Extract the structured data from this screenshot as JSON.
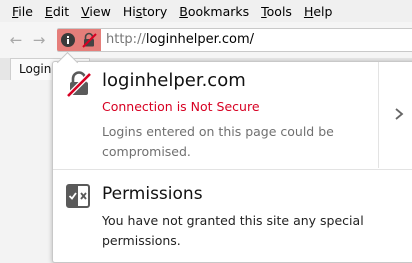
{
  "menu": [
    {
      "key": "F",
      "rest": "ile"
    },
    {
      "key": "E",
      "rest": "dit"
    },
    {
      "key": "V",
      "rest": "iew"
    },
    {
      "key": "",
      "pre": "Hi",
      "ul": "s",
      "rest": "tory"
    },
    {
      "key": "B",
      "rest": "ookmarks"
    },
    {
      "key": "T",
      "rest": "ools"
    },
    {
      "key": "H",
      "rest": "elp"
    }
  ],
  "nav": {
    "back_glyph": "←",
    "forward_glyph": "→",
    "url_protocol": "http://",
    "url_host": "loginhelper.com",
    "url_suffix": "/"
  },
  "tab": {
    "label": "Login I"
  },
  "panel": {
    "host": "loginhelper.com",
    "status": "Connection is Not Secure",
    "description": "Logins entered on this page could be compromised.",
    "permissions_title": "Permissions",
    "permissions_desc": "You have not granted this site any special permissions."
  },
  "colors": {
    "insecure_red": "#d70022",
    "identity_box": "#e57e7a"
  },
  "icons": {
    "info": "info-icon",
    "lock_slash": "lock-slash-icon",
    "chevron": "chevron-right-icon",
    "permissions": "permissions-icon"
  }
}
